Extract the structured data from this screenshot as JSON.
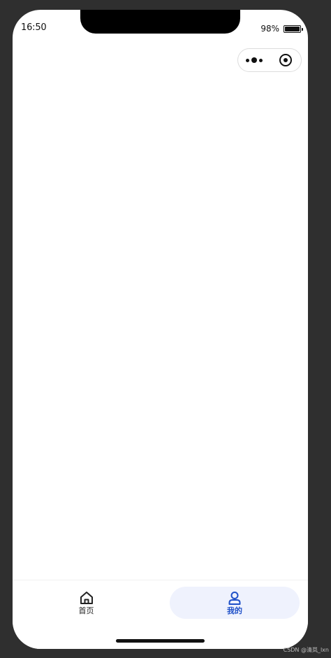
{
  "status_bar": {
    "time": "16:50",
    "battery_percent": "98%",
    "battery_level": 0.98
  },
  "capsule": {
    "more_icon": "more-dots-icon",
    "close_icon": "target-close-icon"
  },
  "tabbar": {
    "active_color": "#1f50c8",
    "items": [
      {
        "label": "首页",
        "icon": "home-icon"
      },
      {
        "label": "我的",
        "icon": "user-icon"
      }
    ]
  },
  "watermark": "CSDN @清岚_lxn"
}
